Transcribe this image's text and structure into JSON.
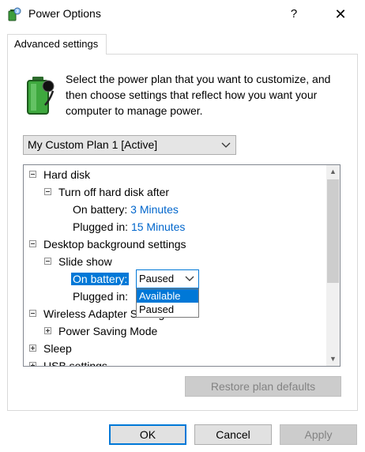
{
  "window": {
    "title": "Power Options",
    "help_label": "?",
    "close_label": "✕"
  },
  "tab": {
    "label": "Advanced settings"
  },
  "description": "Select the power plan that you want to customize, and then choose settings that reflect how you want your computer to manage power.",
  "plan_select": {
    "value": "My Custom Plan 1 [Active]"
  },
  "tree": {
    "hard_disk": {
      "label": "Hard disk",
      "turn_off": {
        "label": "Turn off hard disk after",
        "on_battery_label": "On battery:",
        "on_battery_value": "3 Minutes",
        "plugged_in_label": "Plugged in:",
        "plugged_in_value": "15 Minutes"
      }
    },
    "desktop_bg": {
      "label": "Desktop background settings",
      "slide_show": {
        "label": "Slide show",
        "on_battery_label": "On battery:",
        "on_battery_value": "Paused",
        "plugged_in_label": "Plugged in:",
        "options": [
          "Available",
          "Paused"
        ],
        "highlighted_option": "Available"
      }
    },
    "wireless": {
      "label": "Wireless Adapter Settings",
      "power_saving": {
        "label": "Power Saving Mode"
      }
    },
    "sleep": {
      "label": "Sleep"
    },
    "usb": {
      "label": "USB settings"
    }
  },
  "buttons": {
    "restore": "Restore plan defaults",
    "ok": "OK",
    "cancel": "Cancel",
    "apply": "Apply"
  },
  "colors": {
    "accent": "#0078d7",
    "link": "#0066cc",
    "disabled_text": "#838383"
  },
  "icons": {
    "app": "power-options-icon",
    "battery": "battery-plan-icon",
    "expand": "tree-expand-icon",
    "collapse": "tree-collapse-icon",
    "chevron": "chevron-down-icon"
  }
}
